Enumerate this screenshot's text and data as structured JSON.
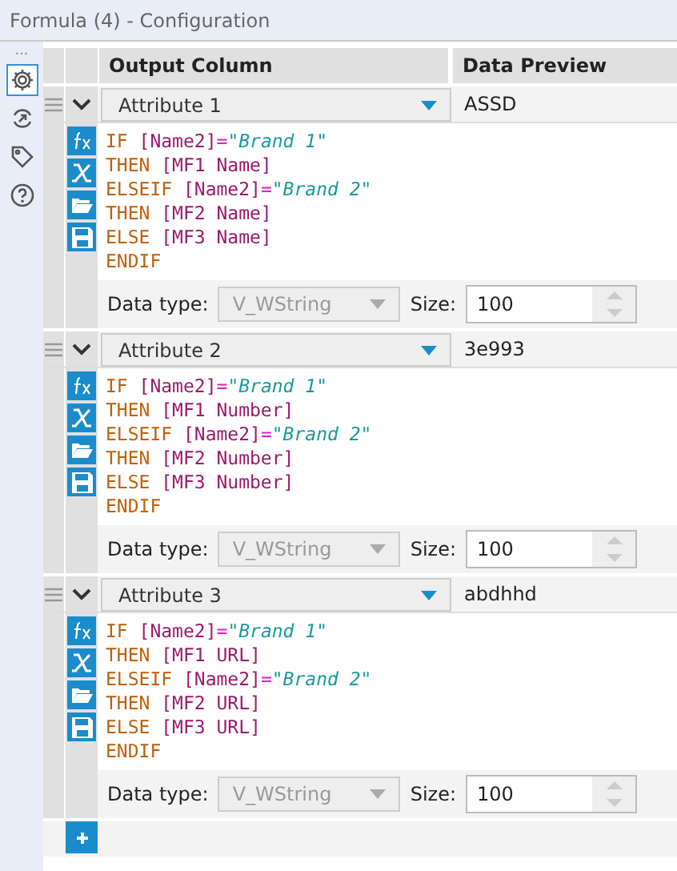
{
  "window": {
    "title": "Formula (4) - Configuration"
  },
  "sidebar": {
    "more": "...",
    "items": [
      {
        "kind": "gear",
        "selected": true
      },
      {
        "kind": "arrows",
        "selected": false
      },
      {
        "kind": "tag",
        "selected": false
      },
      {
        "kind": "help",
        "selected": false
      }
    ]
  },
  "table": {
    "columns": [
      "Output Column",
      "Data Preview"
    ]
  },
  "formulas": [
    {
      "column": "Attribute 1",
      "preview": "ASSD",
      "data_type_label": "Data type:",
      "data_type": "V_WString",
      "size_label": "Size:",
      "size": "100",
      "code": [
        [
          {
            "kind": "keyword",
            "text": "IF "
          },
          {
            "kind": "field",
            "text": "[Name2]"
          },
          {
            "kind": "op",
            "text": "="
          },
          {
            "kind": "string",
            "text": "\"Brand 1\""
          }
        ],
        [
          {
            "kind": "keyword",
            "text": "THEN "
          },
          {
            "kind": "field",
            "text": "[MF1 Name]"
          }
        ],
        [
          {
            "kind": "keyword",
            "text": "ELSEIF "
          },
          {
            "kind": "field",
            "text": "[Name2]"
          },
          {
            "kind": "op",
            "text": "="
          },
          {
            "kind": "string",
            "text": "\"Brand 2\""
          }
        ],
        [
          {
            "kind": "keyword",
            "text": "THEN "
          },
          {
            "kind": "field",
            "text": "[MF2 Name]"
          }
        ],
        [
          {
            "kind": "keyword",
            "text": "ELSE "
          },
          {
            "kind": "field",
            "text": "[MF3 Name]"
          }
        ],
        [
          {
            "kind": "keyword",
            "text": "ENDIF"
          }
        ]
      ]
    },
    {
      "column": "Attribute 2",
      "preview": "3e993",
      "data_type_label": "Data type:",
      "data_type": "V_WString",
      "size_label": "Size:",
      "size": "100",
      "code": [
        [
          {
            "kind": "keyword",
            "text": "IF "
          },
          {
            "kind": "field",
            "text": "[Name2]"
          },
          {
            "kind": "op",
            "text": "="
          },
          {
            "kind": "string",
            "text": "\"Brand 1\""
          }
        ],
        [
          {
            "kind": "keyword",
            "text": "THEN "
          },
          {
            "kind": "field",
            "text": "[MF1 Number]"
          }
        ],
        [
          {
            "kind": "keyword",
            "text": "ELSEIF "
          },
          {
            "kind": "field",
            "text": "[Name2]"
          },
          {
            "kind": "op",
            "text": "="
          },
          {
            "kind": "string",
            "text": "\"Brand 2\""
          }
        ],
        [
          {
            "kind": "keyword",
            "text": "THEN "
          },
          {
            "kind": "field",
            "text": "[MF2 Number]"
          }
        ],
        [
          {
            "kind": "keyword",
            "text": "ELSE "
          },
          {
            "kind": "field",
            "text": "[MF3 Number]"
          }
        ],
        [
          {
            "kind": "keyword",
            "text": "ENDIF"
          }
        ]
      ]
    },
    {
      "column": "Attribute 3",
      "preview": "abdhhd",
      "data_type_label": "Data type:",
      "data_type": "V_WString",
      "size_label": "Size:",
      "size": "100",
      "code": [
        [
          {
            "kind": "keyword",
            "text": "IF "
          },
          {
            "kind": "field",
            "text": "[Name2]"
          },
          {
            "kind": "op",
            "text": "="
          },
          {
            "kind": "string",
            "text": "\"Brand 1\""
          }
        ],
        [
          {
            "kind": "keyword",
            "text": "THEN "
          },
          {
            "kind": "field",
            "text": "[MF1 URL]"
          }
        ],
        [
          {
            "kind": "keyword",
            "text": "ELSEIF "
          },
          {
            "kind": "field",
            "text": "[Name2]"
          },
          {
            "kind": "op",
            "text": "="
          },
          {
            "kind": "string",
            "text": "\"Brand 2\""
          }
        ],
        [
          {
            "kind": "keyword",
            "text": "THEN "
          },
          {
            "kind": "field",
            "text": "[MF2 URL]"
          }
        ],
        [
          {
            "kind": "keyword",
            "text": "ELSE "
          },
          {
            "kind": "field",
            "text": "[MF3 URL]"
          }
        ],
        [
          {
            "kind": "keyword",
            "text": "ENDIF"
          }
        ]
      ]
    }
  ]
}
